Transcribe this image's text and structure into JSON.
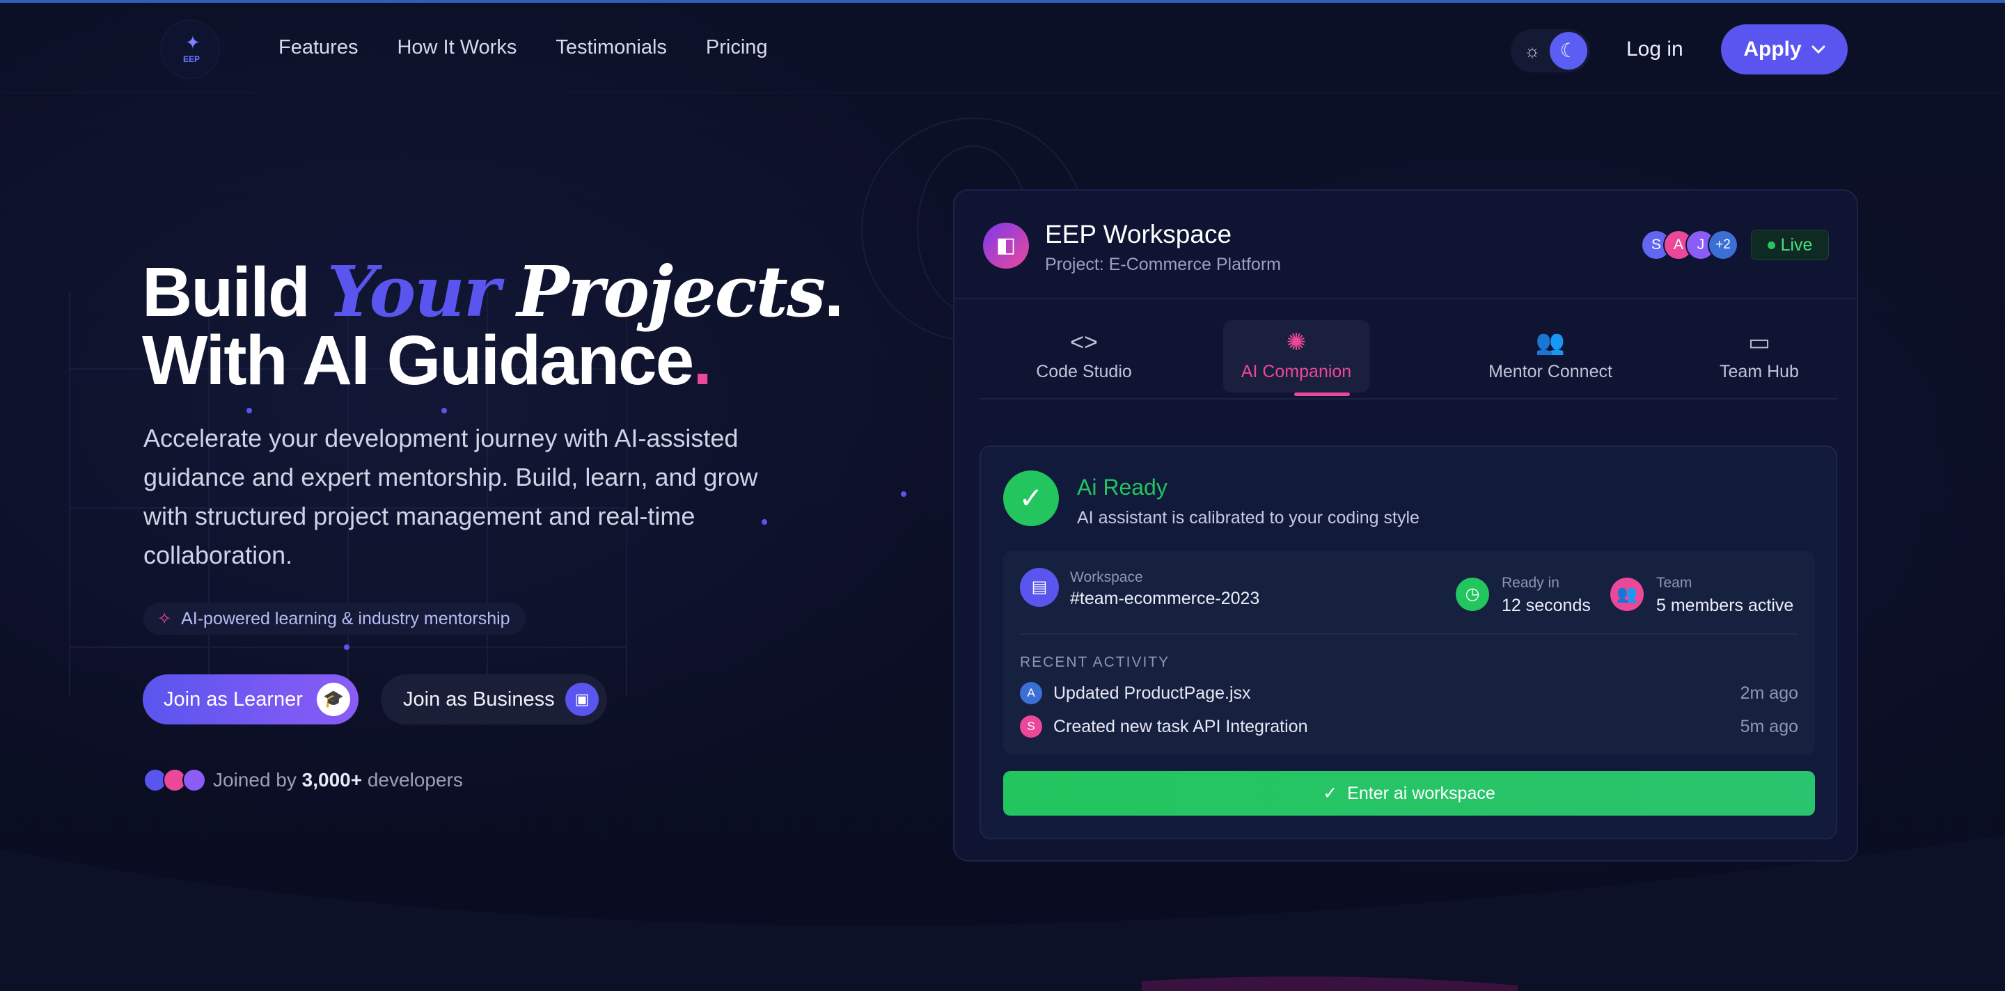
{
  "colors": {
    "accent": "#5a55ee",
    "pink": "#ec4899",
    "green": "#22c55e",
    "bg": "#0b0f24"
  },
  "nav": {
    "logo_text": "EEP",
    "links": [
      "Features",
      "How It Works",
      "Testimonials",
      "Pricing"
    ],
    "login": "Log in",
    "apply": "Apply"
  },
  "hero": {
    "title_build": "Build",
    "title_your": "Your",
    "title_projects": "Projects",
    "title_period": ".",
    "title_line2": "With AI Guidance",
    "title_dot": ".",
    "lead": "Accelerate your development journey with AI-assisted guidance and expert mentorship. Build, learn, and grow with structured project management and real-time collaboration.",
    "pill": "AI-powered learning & industry mentorship",
    "btn_learner": "Join as Learner",
    "btn_business": "Join as Business",
    "joined_prefix": "Joined by",
    "joined_count": "3,000+",
    "joined_suffix": "developers"
  },
  "card": {
    "title": "EEP Workspace",
    "subtitle": "Project: E-Commerce Platform",
    "members": [
      "S",
      "A",
      "J",
      "+2"
    ],
    "live": "Live",
    "tabs": [
      {
        "label": "Code Studio",
        "icon": "code-icon"
      },
      {
        "label": "AI Companion",
        "icon": "brain-icon"
      },
      {
        "label": "Mentor Connect",
        "icon": "users-icon"
      },
      {
        "label": "Team Hub",
        "icon": "chat-icon"
      }
    ],
    "status_title": "Ai Ready",
    "status_sub": "AI assistant is calibrated to your coding style",
    "workspace_label": "Workspace",
    "workspace_value": "#team-ecommerce-2023",
    "ready_label": "Ready in",
    "ready_value": "12 seconds",
    "team_label": "Team",
    "team_value": "5 members active",
    "recent_label": "RECENT ACTIVITY",
    "activity": [
      {
        "avatar": "A",
        "text": "Updated ProductPage.jsx",
        "time": "2m ago"
      },
      {
        "avatar": "S",
        "text": "Created new task API Integration",
        "time": "5m ago"
      }
    ],
    "enter": "Enter ai workspace"
  }
}
